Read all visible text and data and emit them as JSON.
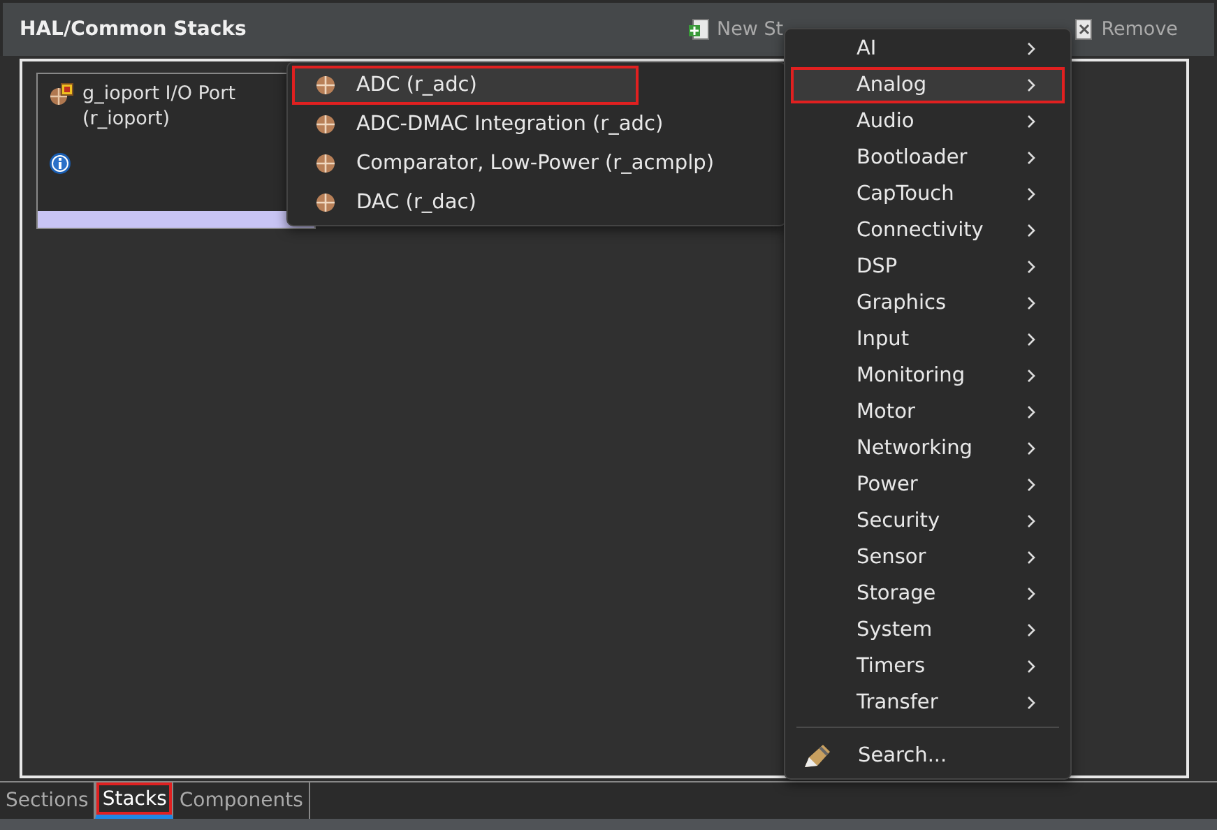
{
  "panel": {
    "title": "HAL/Common Stacks",
    "toolbar": [
      {
        "kind": "new",
        "label": "New St"
      },
      {
        "kind": "remove",
        "label": "Remove"
      }
    ]
  },
  "stack_card": {
    "name": "g_ioport I/O Port",
    "module": "(r_ioport)"
  },
  "submenu": {
    "items": [
      {
        "label": "ADC (r_adc)",
        "selected": true,
        "annotated": true
      },
      {
        "label": "ADC-DMAC Integration (r_adc)",
        "selected": false,
        "annotated": false
      },
      {
        "label": "Comparator, Low-Power (r_acmplp)",
        "selected": false,
        "annotated": false
      },
      {
        "label": "DAC (r_dac)",
        "selected": false,
        "annotated": false
      }
    ]
  },
  "menu": {
    "items": [
      {
        "kind": "submenu",
        "label": "AI",
        "selected": false,
        "annotated": false
      },
      {
        "kind": "submenu",
        "label": "Analog",
        "selected": true,
        "annotated": true
      },
      {
        "kind": "submenu",
        "label": "Audio",
        "selected": false,
        "annotated": false
      },
      {
        "kind": "submenu",
        "label": "Bootloader",
        "selected": false,
        "annotated": false
      },
      {
        "kind": "submenu",
        "label": "CapTouch",
        "selected": false,
        "annotated": false
      },
      {
        "kind": "submenu",
        "label": "Connectivity",
        "selected": false,
        "annotated": false
      },
      {
        "kind": "submenu",
        "label": "DSP",
        "selected": false,
        "annotated": false
      },
      {
        "kind": "submenu",
        "label": "Graphics",
        "selected": false,
        "annotated": false
      },
      {
        "kind": "submenu",
        "label": "Input",
        "selected": false,
        "annotated": false
      },
      {
        "kind": "submenu",
        "label": "Monitoring",
        "selected": false,
        "annotated": false
      },
      {
        "kind": "submenu",
        "label": "Motor",
        "selected": false,
        "annotated": false
      },
      {
        "kind": "submenu",
        "label": "Networking",
        "selected": false,
        "annotated": false
      },
      {
        "kind": "submenu",
        "label": "Power",
        "selected": false,
        "annotated": false
      },
      {
        "kind": "submenu",
        "label": "Security",
        "selected": false,
        "annotated": false
      },
      {
        "kind": "submenu",
        "label": "Sensor",
        "selected": false,
        "annotated": false
      },
      {
        "kind": "submenu",
        "label": "Storage",
        "selected": false,
        "annotated": false
      },
      {
        "kind": "submenu",
        "label": "System",
        "selected": false,
        "annotated": false
      },
      {
        "kind": "submenu",
        "label": "Timers",
        "selected": false,
        "annotated": false
      },
      {
        "kind": "submenu",
        "label": "Transfer",
        "selected": false,
        "annotated": false
      },
      {
        "kind": "separator"
      },
      {
        "kind": "action",
        "label": "Search...",
        "selected": false,
        "annotated": false
      }
    ]
  },
  "tabs": [
    {
      "label": "Sections",
      "selected": false,
      "annotated": false
    },
    {
      "label": "Stacks",
      "selected": true,
      "annotated": true
    },
    {
      "label": "Components",
      "selected": false,
      "annotated": false
    }
  ]
}
